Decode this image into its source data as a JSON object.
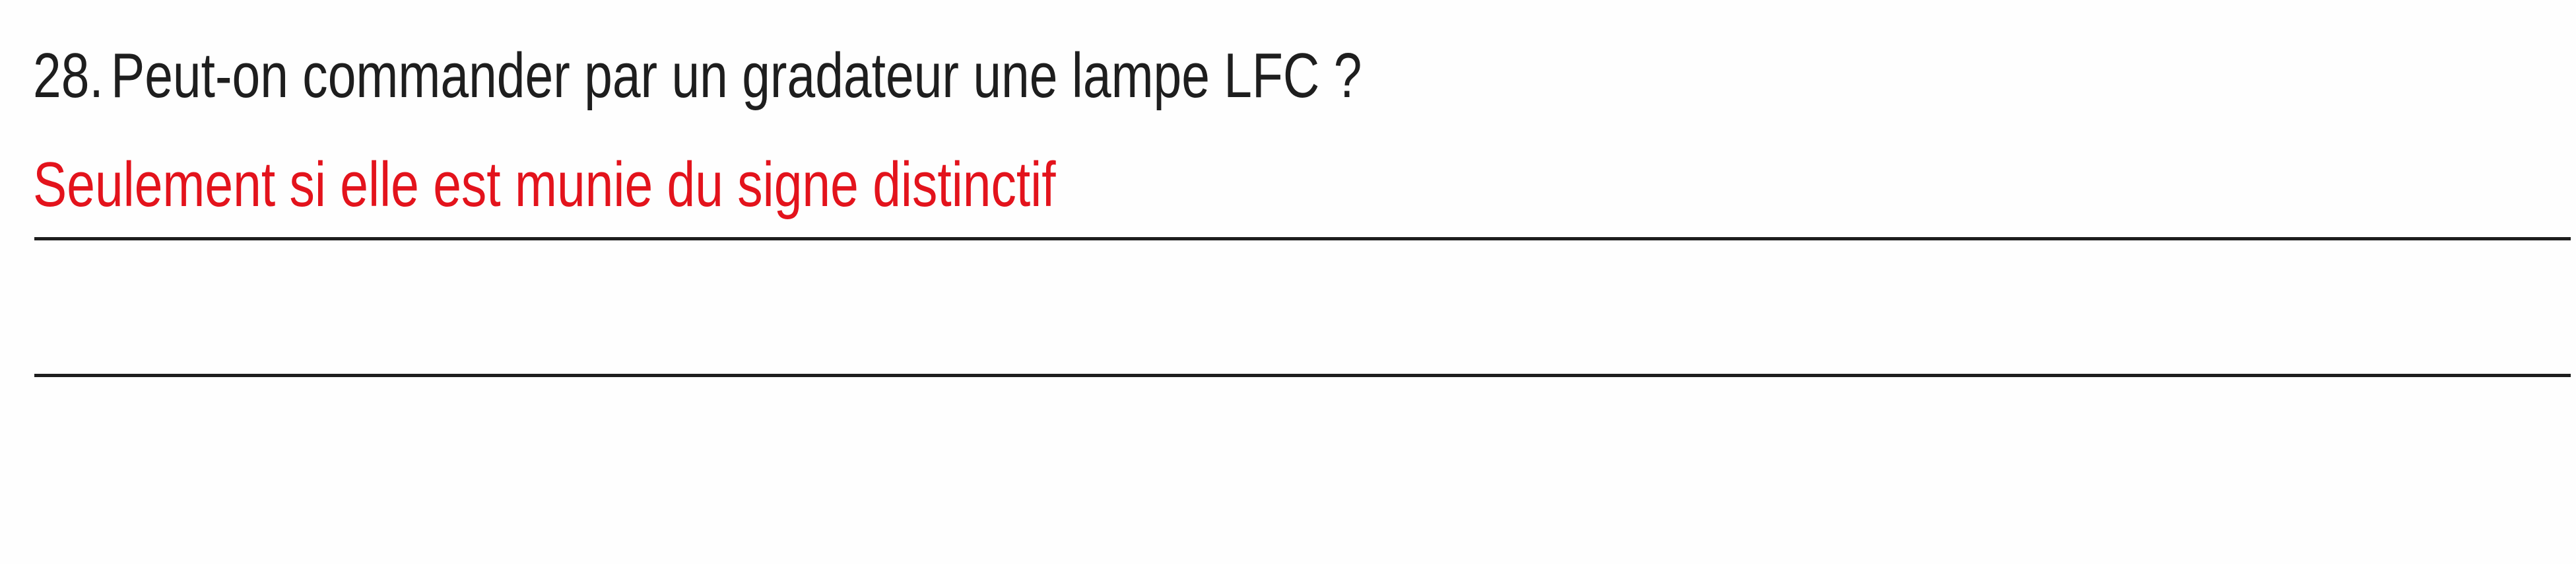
{
  "question": {
    "number": "28.",
    "text": "Peut-on commander par un gradateur une lampe LFC ?"
  },
  "answer": {
    "text": "Seulement si elle est munie du signe distinctif",
    "color": "#e3131c"
  }
}
